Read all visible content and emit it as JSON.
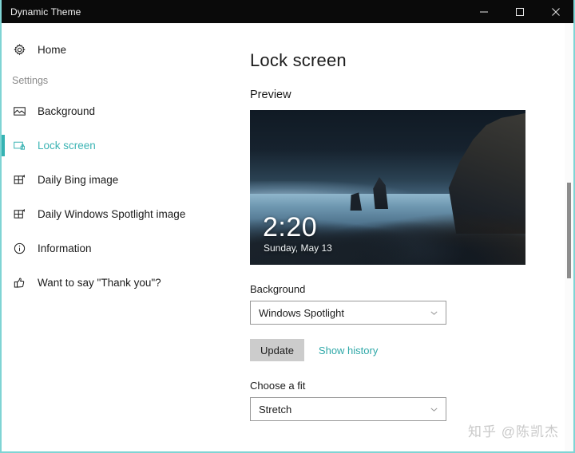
{
  "window": {
    "title": "Dynamic Theme",
    "controls": {
      "minimize": "minimize-button",
      "maximize": "maximize-button",
      "close": "close-button"
    },
    "accent_color": "#36b3b3",
    "titlebar_color": "#0a0a0a"
  },
  "sidebar": {
    "home": {
      "label": "Home",
      "icon": "gear-icon"
    },
    "section_label": "Settings",
    "items": [
      {
        "label": "Background",
        "icon": "picture-icon",
        "selected": false
      },
      {
        "label": "Lock screen",
        "icon": "monitor-lock-icon",
        "selected": true
      },
      {
        "label": "Daily Bing image",
        "icon": "window-grid-icon",
        "selected": false
      },
      {
        "label": "Daily Windows Spotlight image",
        "icon": "window-grid-icon",
        "selected": false
      },
      {
        "label": "Information",
        "icon": "info-circle-icon",
        "selected": false
      },
      {
        "label": "Want to say \"Thank you\"?",
        "icon": "thumbs-up-icon",
        "selected": false
      }
    ]
  },
  "main": {
    "page_title": "Lock screen",
    "preview_heading": "Preview",
    "preview": {
      "clock_time": "2:20",
      "clock_date": "Sunday, May 13"
    },
    "background": {
      "label": "Background",
      "selected": "Windows Spotlight"
    },
    "actions": {
      "update_label": "Update",
      "history_label": "Show history",
      "link_color": "#2fa8a8"
    },
    "fit": {
      "label": "Choose a fit",
      "selected": "Stretch"
    }
  },
  "watermark": {
    "text": "知乎 @陈凯杰"
  }
}
